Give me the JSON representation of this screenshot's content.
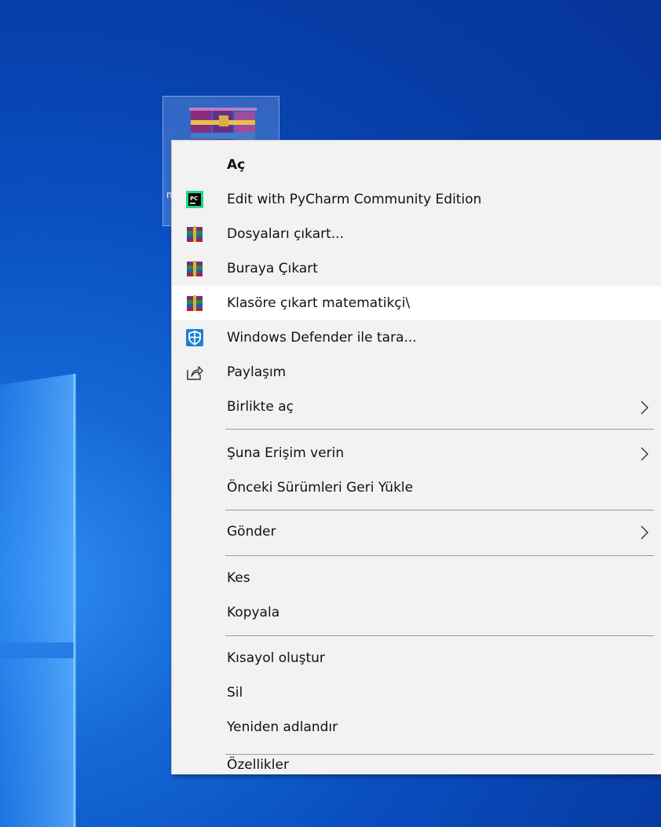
{
  "desktop": {
    "icon_label_fragment": "m"
  },
  "context_menu": {
    "items": [
      {
        "label": "Aç",
        "icon": "none",
        "bold": true
      },
      {
        "label": "Edit with PyCharm Community Edition",
        "icon": "pycharm-icon"
      },
      {
        "label": "Dosyaları çıkart...",
        "icon": "winrar-icon"
      },
      {
        "label": "Buraya Çıkart",
        "icon": "winrar-icon"
      },
      {
        "label": "Klasöre çıkart matematikçi\\",
        "icon": "winrar-icon",
        "highlighted": true
      },
      {
        "label": "Windows Defender ile tara...",
        "icon": "defender-shield-icon"
      },
      {
        "label": "Paylaşım",
        "icon": "share-icon"
      },
      {
        "label": "Birlikte aç",
        "icon": "none",
        "submenu": true
      },
      {
        "label": "Şuna Erişim verin",
        "icon": "none",
        "submenu": true
      },
      {
        "label": "Önceki Sürümleri Geri Yükle",
        "icon": "none"
      },
      {
        "label": "Gönder",
        "icon": "none",
        "submenu": true
      },
      {
        "label": "Kes",
        "icon": "none"
      },
      {
        "label": "Kopyala",
        "icon": "none"
      },
      {
        "label": "Kısayol oluştur",
        "icon": "none"
      },
      {
        "label": "Sil",
        "icon": "none"
      },
      {
        "label": "Yeniden adlandır",
        "icon": "none"
      },
      {
        "label": "Özellikler",
        "icon": "none"
      }
    ]
  },
  "colors": {
    "menu_background": "#f2f2f2",
    "menu_highlight": "#ffffff",
    "desktop_blue": "#0a4fc2"
  }
}
